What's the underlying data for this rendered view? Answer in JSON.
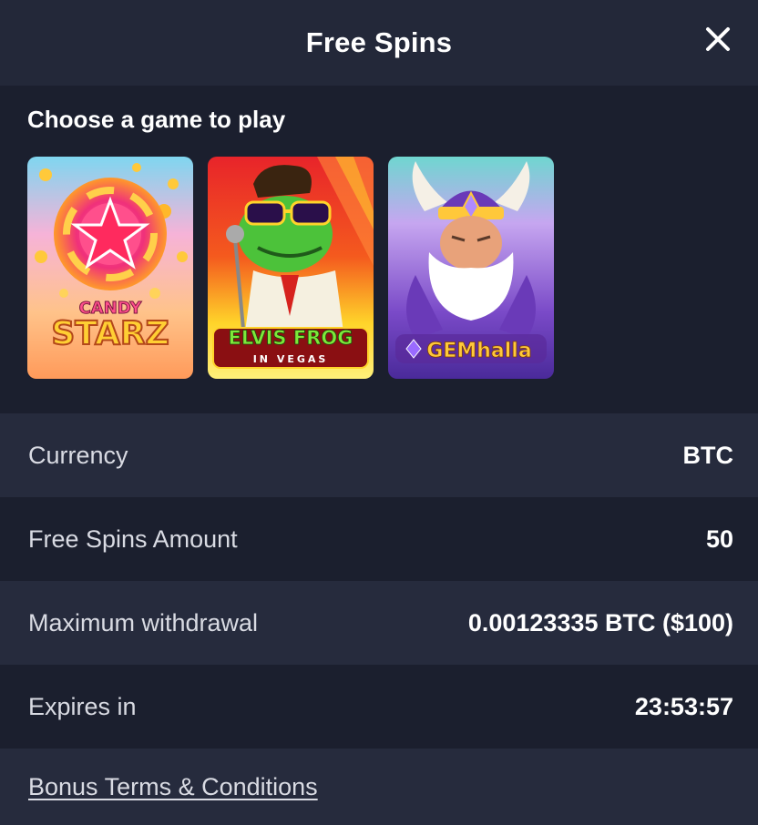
{
  "header": {
    "title": "Free Spins",
    "close_icon": "close-icon"
  },
  "games": {
    "title": "Choose a game to play",
    "items": [
      {
        "name": "CANDY STARZ",
        "logo_top": "CANDY",
        "logo_bottom": "STARZ"
      },
      {
        "name": "ELVIS FROG IN VEGAS",
        "logo_top": "ELVIS FROG",
        "logo_bottom": "IN VEGAS"
      },
      {
        "name": "GEMHALLA",
        "logo_top": "GEMhalla"
      }
    ]
  },
  "details": [
    {
      "label": "Currency",
      "value": "BTC"
    },
    {
      "label": "Free Spins Amount",
      "value": "50"
    },
    {
      "label": "Maximum withdrawal",
      "value": "0.00123335 BTC ($100)"
    },
    {
      "label": "Expires in",
      "value": "23:53:57"
    }
  ],
  "terms_link": "Bonus Terms & Conditions",
  "colors": {
    "background": "#1b1f2e",
    "header_bg": "#232839",
    "row_alt_bg": "#262b3d",
    "label_text": "#d9dbe3"
  }
}
